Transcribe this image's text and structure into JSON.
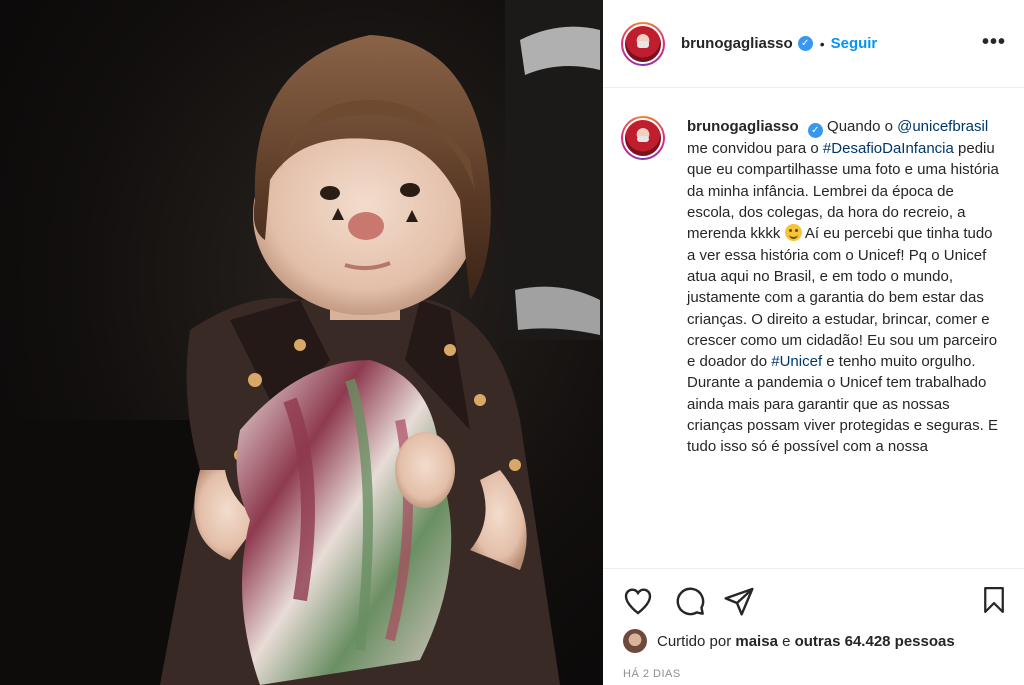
{
  "post": {
    "photo_alt": "Foto de infância de Bruno Gagliasso fantasiado de palhaço",
    "header": {
      "username": "brunogagliasso",
      "separator": "•",
      "follow_label": "Seguir",
      "more_label": "•••"
    },
    "caption": {
      "username": "brunogagliasso",
      "text_1": " Quando o ",
      "mention": "@unicefbrasil",
      "text_2": " me convidou para o ",
      "hashtag_1": "#DesafioDaInfancia",
      "text_3": " pediu que eu compartilhasse uma foto e uma história da minha infância. Lembrei da época de escola, dos colegas, da hora do recreio, a merenda kkkk ",
      "text_4": " Aí eu percebi que tinha tudo a ver essa história com o Unicef! Pq o Unicef atua aqui no Brasil, e em todo o mundo, justamente com a garantia do bem estar das crianças. O direito a estudar, brincar, comer e crescer como um cidadão! Eu sou um parceiro e doador do ",
      "hashtag_2": "#Unicef",
      "text_5": " e tenho muito orgulho. Durante a pandemia o Unicef tem trabalhado ainda mais para garantir que as nossas crianças possam viver protegidas e seguras. E tudo isso só é possível com a nossa"
    },
    "actions": {
      "like_icon": "heart-icon",
      "comment_icon": "comment-icon",
      "share_icon": "paper-plane-icon",
      "save_icon": "bookmark-icon"
    },
    "likes": {
      "prefix": "Curtido por ",
      "first_user": "maisa",
      "middle": " e ",
      "others": "outras 64.428 pessoas"
    },
    "timestamp": "HÁ 2 DIAS"
  },
  "colors": {
    "link_blue": "#0095f6",
    "mention_blue": "#00376b",
    "verified_blue": "#3897f0",
    "text": "#262626",
    "muted": "#8e8e8e"
  }
}
